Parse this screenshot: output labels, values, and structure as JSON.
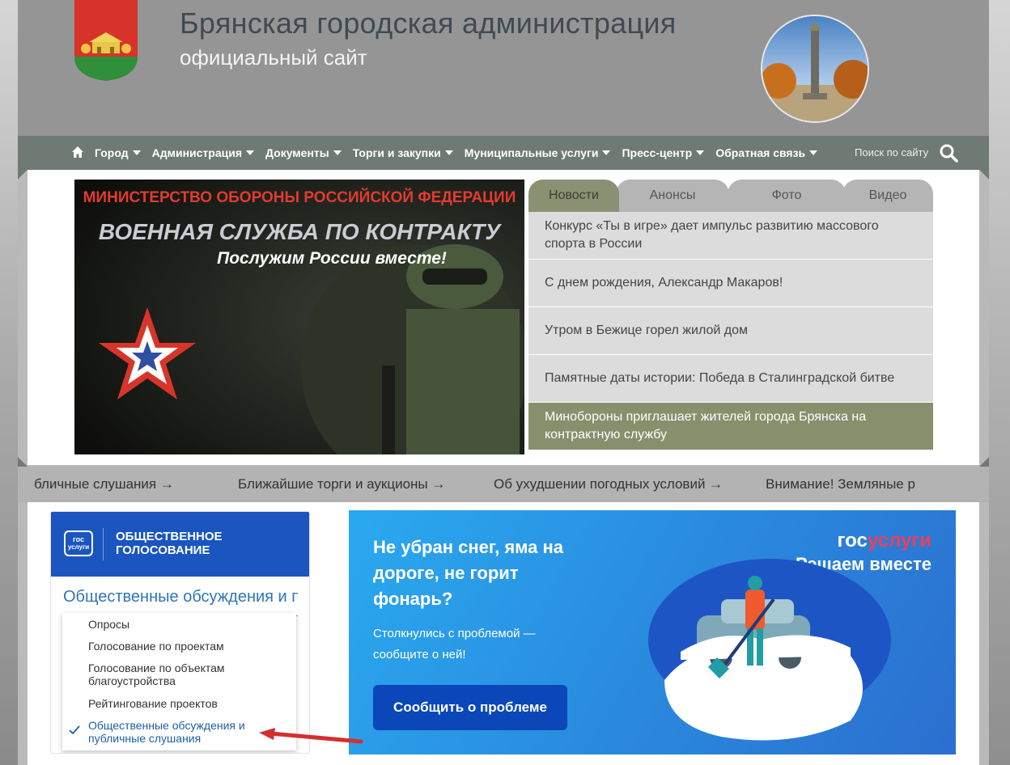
{
  "header": {
    "title": "Брянская городская администрация",
    "subtitle": "официальный сайт"
  },
  "nav": {
    "items": [
      {
        "label": "Город"
      },
      {
        "label": "Администрация"
      },
      {
        "label": "Документы"
      },
      {
        "label": "Торги и закупки"
      },
      {
        "label": "Муниципальные услуги"
      },
      {
        "label": "Пресс-центр"
      },
      {
        "label": "Обратная связь"
      }
    ],
    "search_label": "Поиск по сайту"
  },
  "banner": {
    "line1": "МИНИСТЕРСТВО ОБОРОНЫ РОССИЙСКОЙ ФЕДЕРАЦИИ",
    "line2": "ВОЕННАЯ СЛУЖБА ПО КОНТРАКТУ",
    "line3": "Послужим России вместе!"
  },
  "tabs": {
    "items": [
      "Новости",
      "Анонсы",
      "Фото",
      "Видео"
    ],
    "active": "Новости"
  },
  "news": [
    "Конкурс «Ты в игре» дает импульс развитию массового спорта в России",
    "С днем рождения, Александр Макаров!",
    "Утром в Бежице горел жилой дом",
    "Памятные даты истории: Победа в Сталинградской битве",
    "Минобороны приглашает жителей города Брянска на контрактную службу"
  ],
  "ticker": [
    "бличные слушания →",
    "Ближайшие торги и аукционы →",
    "Об ухудшении погодных условий →",
    "Внимание! Земляные р"
  ],
  "vote": {
    "logo_text_1": "гос",
    "logo_text_2": "услуги",
    "title_1": "ОБЩЕСТВЕННОЕ",
    "title_2": "ГОЛОСОВАНИЕ",
    "selected": "Общественные обсуждения и публичные слушания",
    "options": [
      "Опросы",
      "Голосование по проектам",
      "Голосование по объектам благоустройства",
      "Рейтингование проектов",
      "Общественные обсуждения и публичные слушания"
    ]
  },
  "gosuslugi": {
    "headline": "Не убран снег, яма на дороге, не горит фонарь?",
    "text": "Столкнулись с проблемой — сообщите о ней!",
    "button": "Сообщить о проблеме",
    "brand_a": "гос",
    "brand_b": "услуги",
    "slogan": "Решаем вместе"
  },
  "colors": {
    "header_bg": "#959595",
    "nav_bg": "#6f7a74",
    "tab_active": "#8a9173",
    "news_highlight": "#888f6c",
    "vote_blue": "#1a55c0",
    "button_blue": "#0b47b8",
    "arrow_red": "#d32f2f"
  }
}
